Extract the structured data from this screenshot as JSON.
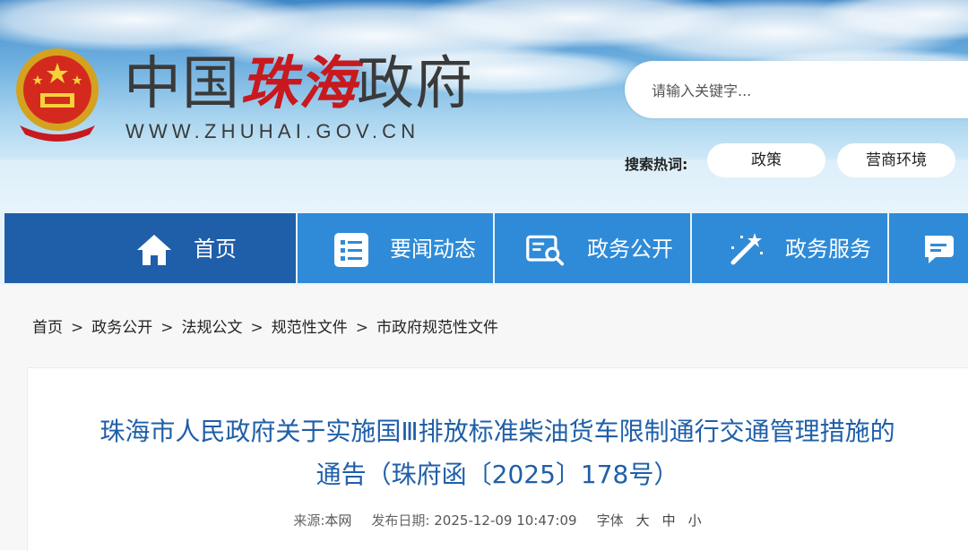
{
  "header": {
    "site_name_prefix": "中国",
    "site_name_city": "珠海",
    "site_name_suffix": "政府",
    "domain": "WWW.ZHUHAI.GOV.CN",
    "search": {
      "placeholder": "请输入关键字..."
    },
    "hot_search": {
      "label": "搜索热词:",
      "tags": [
        "政策",
        "营商环境"
      ]
    }
  },
  "nav": {
    "items": [
      {
        "label": "首页",
        "icon": "home-icon",
        "active": true
      },
      {
        "label": "要闻动态",
        "icon": "news-list-icon",
        "active": false
      },
      {
        "label": "政务公开",
        "icon": "search-document-icon",
        "active": false
      },
      {
        "label": "政务服务",
        "icon": "magic-wand-icon",
        "active": false
      },
      {
        "label": "",
        "icon": "chat-icon",
        "active": false
      }
    ]
  },
  "breadcrumb": {
    "items": [
      "首页",
      "政务公开",
      "法规公文",
      "规范性文件",
      "市政府规范性文件"
    ],
    "separator": ">"
  },
  "article": {
    "title_line1": "珠海市人民政府关于实施国Ⅲ排放标准柴油货车限制通行交通管理措施的",
    "title_line2": "通告（珠府函〔2025〕178号）",
    "source_label": "来源:",
    "source_value": "本网",
    "date_label": "发布日期:",
    "date_value": "2025-12-09 10:47:09",
    "font_size_label": "字体",
    "font_sizes": [
      "大",
      "中",
      "小"
    ]
  },
  "colors": {
    "nav_blue": "#2f8bd7",
    "nav_active": "#1f5faa",
    "title_blue": "#1f5fa8",
    "city_red": "#c8191f"
  }
}
